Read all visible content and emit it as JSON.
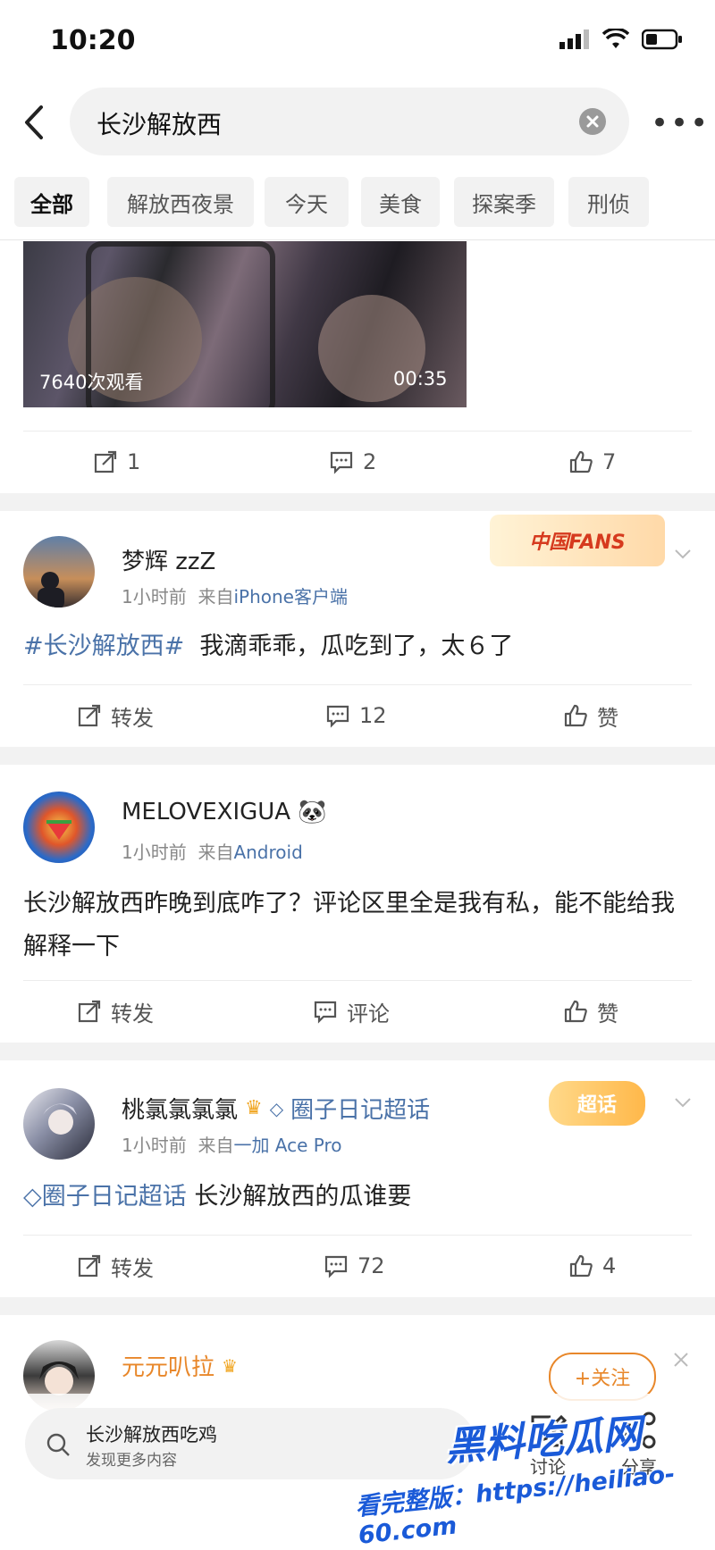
{
  "status_bar": {
    "time": "10:20"
  },
  "search": {
    "query": "长沙解放西"
  },
  "filters": [
    "全部",
    "解放西夜景",
    "今天",
    "美食",
    "探案季",
    "刑侦"
  ],
  "video_post": {
    "views": "7640次观看",
    "duration": "00:35",
    "reposts": "1",
    "comments": "2",
    "likes": "7"
  },
  "posts": [
    {
      "username": "梦辉 zzZ",
      "time": "1小时前",
      "source_prefix": "来自",
      "source": "iPhone客户端",
      "badge": "中国FANS",
      "topic": "#长沙解放西#",
      "text": "我滴乖乖，瓜吃到了，太６了",
      "repost": "转发",
      "comments": "12",
      "like": "赞"
    },
    {
      "username": "MELOVEXIGUA",
      "emoji": "🐼",
      "time": "1小时前",
      "source_prefix": "来自",
      "source": "Android",
      "text": "长沙解放西昨晚到底咋了？评论区里全是我有私，能不能给我解释一下",
      "repost": "转发",
      "comment": "评论",
      "like": "赞"
    },
    {
      "username": "桃氯氯氯氯",
      "supertopic": "圈子日记超话",
      "time": "1小时前",
      "source_prefix": "来自",
      "source": "一加 Ace Pro",
      "badge": "超话",
      "topic": "圈子日记超话",
      "text": "长沙解放西的瓜谁要",
      "repost": "转发",
      "comments": "72",
      "likes": "4"
    },
    {
      "username": "元元叭拉",
      "follow": "+关注"
    }
  ],
  "bottom_bar": {
    "search_title": "长沙解放西吃鸡",
    "search_sub": "发现更多内容",
    "discuss": "讨论",
    "share": "分享"
  },
  "watermark": {
    "brand": "黑料吃瓜网",
    "url": "看完整版：https://heiliao-60.com"
  },
  "colors": {
    "link": "#4a72a8",
    "watermark": "#1a5ad8",
    "follow": "#e8872a"
  }
}
